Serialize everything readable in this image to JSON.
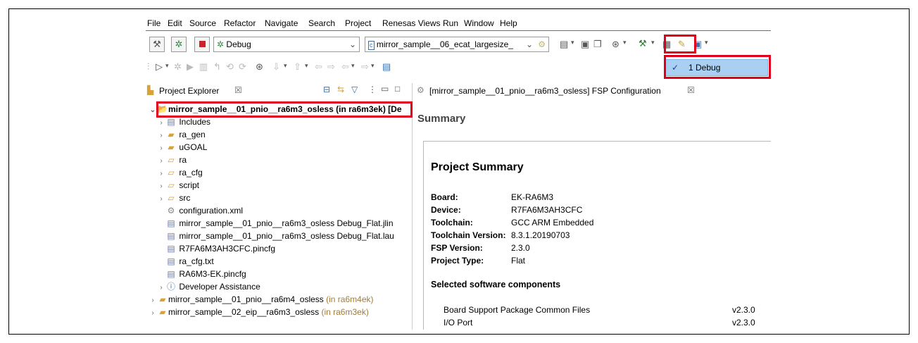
{
  "menu": [
    "File",
    "Edit",
    "Source",
    "Refactor",
    "Navigate",
    "Search",
    "Project",
    "Renesas Views",
    "Run",
    "Window",
    "Help"
  ],
  "toolbar": {
    "launch_mode": "Debug",
    "launch_config": "mirror_sample__06_ecat_largesize_",
    "build_dropdown_item": "1 Debug",
    "check_mark": "✓"
  },
  "project_explorer": {
    "tab_label": "Project Explorer",
    "close_glyph": "☒",
    "root": "mirror_sample__01_pnio__ra6m3_osless (in ra6m3ek) [De",
    "items": [
      {
        "label": "Includes",
        "icon": "includes-icon",
        "twisty": "›"
      },
      {
        "label": "ra_gen",
        "icon": "source-folder-icon",
        "twisty": "›"
      },
      {
        "label": "uGOAL",
        "icon": "source-folder-icon",
        "twisty": "›"
      },
      {
        "label": "ra",
        "icon": "folder-icon",
        "twisty": "›"
      },
      {
        "label": "ra_cfg",
        "icon": "folder-icon",
        "twisty": "›"
      },
      {
        "label": "script",
        "icon": "folder-icon",
        "twisty": "›"
      },
      {
        "label": "src",
        "icon": "folder-icon",
        "twisty": "›"
      },
      {
        "label": "configuration.xml",
        "icon": "gear-icon",
        "twisty": ""
      },
      {
        "label": "mirror_sample__01_pnio__ra6m3_osless Debug_Flat.jlin",
        "icon": "file-icon",
        "twisty": ""
      },
      {
        "label": "mirror_sample__01_pnio__ra6m3_osless Debug_Flat.lau",
        "icon": "file-icon",
        "twisty": ""
      },
      {
        "label": "R7FA6M3AH3CFC.pincfg",
        "icon": "file-icon",
        "twisty": ""
      },
      {
        "label": "ra_cfg.txt",
        "icon": "file-icon",
        "twisty": ""
      },
      {
        "label": "RA6M3-EK.pincfg",
        "icon": "file-icon",
        "twisty": ""
      },
      {
        "label": "Developer Assistance",
        "icon": "help-icon",
        "twisty": "›"
      }
    ],
    "other_projects": [
      {
        "name": "mirror_sample__01_pnio__ra6m4_osless",
        "suffix": " (in ra6m4ek)"
      },
      {
        "name": "mirror_sample__02_eip__ra6m3_osless",
        "suffix": " (in ra6m3ek)"
      }
    ]
  },
  "editor": {
    "tab_label": "[mirror_sample__01_pnio__ra6m3_osless] FSP Configuration",
    "close_glyph": "☒",
    "heading": "Summary",
    "project_summary_title": "Project Summary",
    "summary": [
      {
        "key": "Board:",
        "value": "EK-RA6M3"
      },
      {
        "key": "Device:",
        "value": "R7FA6M3AH3CFC"
      },
      {
        "key": "Toolchain:",
        "value": "GCC ARM Embedded"
      },
      {
        "key": "Toolchain Version:",
        "value": "8.3.1.20190703"
      },
      {
        "key": "FSP Version:",
        "value": "2.3.0"
      },
      {
        "key": "Project Type:",
        "value": "Flat"
      }
    ],
    "components_title": "Selected software components",
    "components": [
      {
        "name": "Board Support Package Common Files",
        "version": "v2.3.0"
      },
      {
        "name": "I/O Port",
        "version": "v2.3.0"
      }
    ]
  },
  "colors": {
    "highlight": "#e0001b",
    "dropdown_selection": "#a9d0f2"
  }
}
